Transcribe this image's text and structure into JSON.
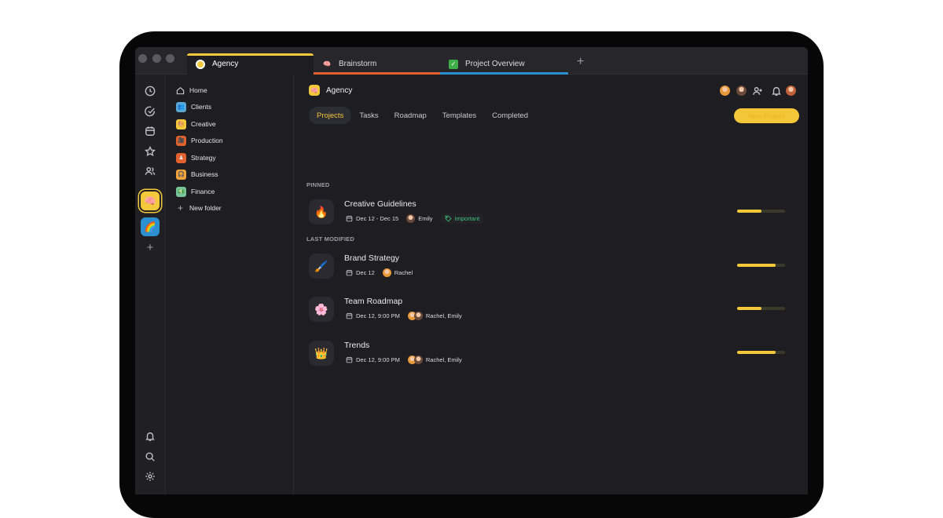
{
  "tabs": [
    {
      "label": "Agency",
      "icon": "agency-icon",
      "color": "#f3c93b"
    },
    {
      "label": "Brainstorm",
      "icon": "brain-icon",
      "color": "#e1612f"
    },
    {
      "label": "Project Overview",
      "icon": "check-icon",
      "color": "#2c8fcf"
    }
  ],
  "sidebar": {
    "items": [
      {
        "label": "Home",
        "icon": "home-icon"
      },
      {
        "label": "Clients",
        "icon": "clients-folder-icon",
        "color": "#58a7d6"
      },
      {
        "label": "Creative",
        "icon": "creative-folder-icon",
        "color": "#f3c93b"
      },
      {
        "label": "Production",
        "icon": "production-folder-icon",
        "color": "#e1612f"
      },
      {
        "label": "Strategy",
        "icon": "strategy-folder-icon",
        "color": "#e1612f"
      },
      {
        "label": "Business",
        "icon": "business-folder-icon",
        "color": "#f2a23a"
      },
      {
        "label": "Finance",
        "icon": "finance-folder-icon",
        "color": "#79c39a"
      },
      {
        "label": "New folder",
        "icon": "plus-icon"
      }
    ]
  },
  "workspace": {
    "title": "Agency"
  },
  "project_tabs": [
    "Projects",
    "Tasks",
    "Roadmap",
    "Templates",
    "Completed"
  ],
  "new_project_label": "New Project",
  "sections": {
    "pinned": "PINNED",
    "last_modified": "LAST MODIFIED"
  },
  "projects": [
    {
      "title": "Creative Guidelines",
      "icon": "fire-icon",
      "glyph": "🔥",
      "date": "Dec 12 - Dec 15",
      "people": "Emily",
      "tag": "Important",
      "progress": 0.5
    },
    {
      "title": "Brand Strategy",
      "icon": "brush-icon",
      "glyph": "🖌️",
      "date": "Dec 12",
      "people": "Rachel",
      "progress": 0.8
    },
    {
      "title": "Team Roadmap",
      "icon": "flower-icon",
      "glyph": "🌸",
      "date": "Dec 12, 9:00 PM",
      "people": "Rachel, Emily",
      "progress": 0.5
    },
    {
      "title": "Trends",
      "icon": "crown-icon",
      "glyph": "👑",
      "date": "Dec 12, 9:00 PM",
      "people": "Rachel, Emily",
      "progress": 0.8
    }
  ]
}
